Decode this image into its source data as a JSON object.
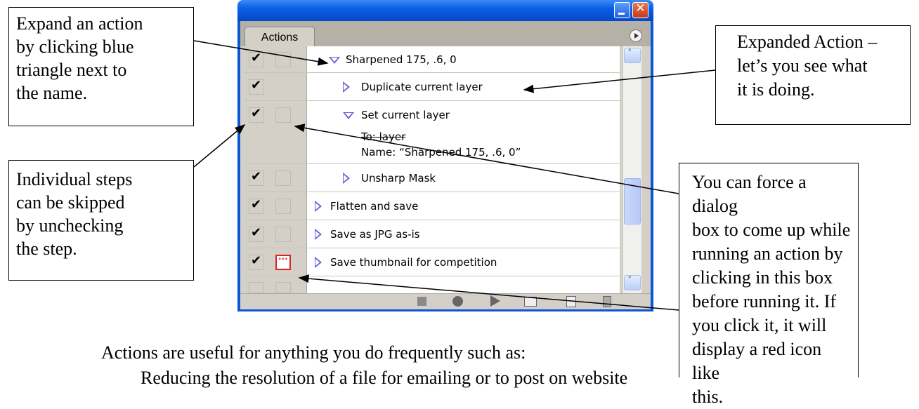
{
  "callouts": {
    "expand": [
      "Expand an action",
      "by clicking blue",
      "triangle next to",
      "the name."
    ],
    "skip": [
      "Individual steps",
      "can be skipped",
      "by unchecking",
      "the step."
    ],
    "expanded": [
      "Expanded Action –",
      "let’s you see what",
      "it is doing."
    ],
    "dialog": [
      "You can force a dialog",
      "box to come up while",
      "running an action by",
      "clicking in this box",
      "before running it. If",
      "you click it, it will",
      "display a red icon like",
      "this."
    ]
  },
  "footer": {
    "line1": "Actions are useful for anything you do frequently such as:",
    "line2": "Reducing the resolution of a file for emailing or to post on website"
  },
  "window": {
    "tab_label": "Actions",
    "close_glyph": "✕"
  },
  "actions": {
    "rows": [
      {
        "label": "Sharpened 175, .6, 0",
        "checked": true,
        "dialog": "empty",
        "expanded": true
      },
      {
        "label": "Duplicate current layer",
        "checked": true,
        "dialog": "none",
        "expanded": false
      },
      {
        "label": "Set current layer",
        "checked": true,
        "dialog": "empty",
        "expanded": true
      },
      {
        "label": "To: layer",
        "detail": true
      },
      {
        "label": "Name:  “Sharpened 175, .6, 0”",
        "detail": true
      },
      {
        "label": "Unsharp Mask",
        "checked": true,
        "dialog": "empty",
        "expanded": false
      },
      {
        "label": "Flatten and save",
        "checked": true,
        "dialog": "empty",
        "expanded": false
      },
      {
        "label": "Save as JPG as-is",
        "checked": true,
        "dialog": "empty",
        "expanded": false
      },
      {
        "label": "Save thumbnail for competition",
        "checked": true,
        "dialog": "red",
        "expanded": false
      }
    ],
    "check_glyph": "✔"
  },
  "scrollbar": {
    "up_glyph": "˄",
    "down_glyph": "˅"
  },
  "colors": {
    "titlebar": "#0a5ee6",
    "triangle": "#6a5fd6",
    "dialog_active": "#d22222"
  }
}
